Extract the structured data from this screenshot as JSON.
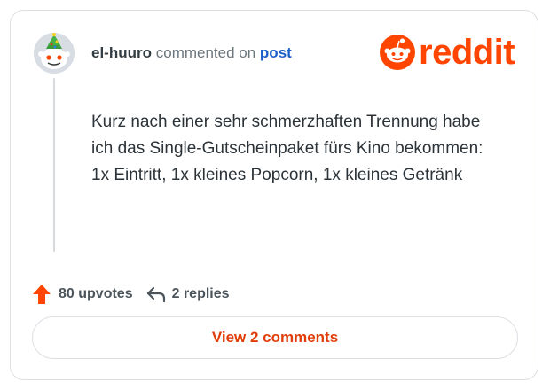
{
  "comment": {
    "username": "el-huuro",
    "action_text": "commented on",
    "post_link_label": "post",
    "body": "Kurz nach einer sehr schmerzhaften Trennung habe ich das Single-Gutscheinpaket fürs Kino bekommen: 1x Eintritt, 1x kleines Popcorn, 1x kleines Getränk"
  },
  "brand": {
    "wordmark": "reddit",
    "color": "#ff4500",
    "icon": "reddit-snoo-icon"
  },
  "stats": {
    "upvotes_label": "80 upvotes",
    "replies_label": "2 replies",
    "upvote_icon": "arrow-up-icon",
    "reply_icon": "reply-arrow-icon"
  },
  "buttons": {
    "view_comments_label": "View 2 comments"
  },
  "colors": {
    "link_blue": "#1c5ec8",
    "button_text": "#e23e0b",
    "upvote_orange": "#ff4500"
  }
}
